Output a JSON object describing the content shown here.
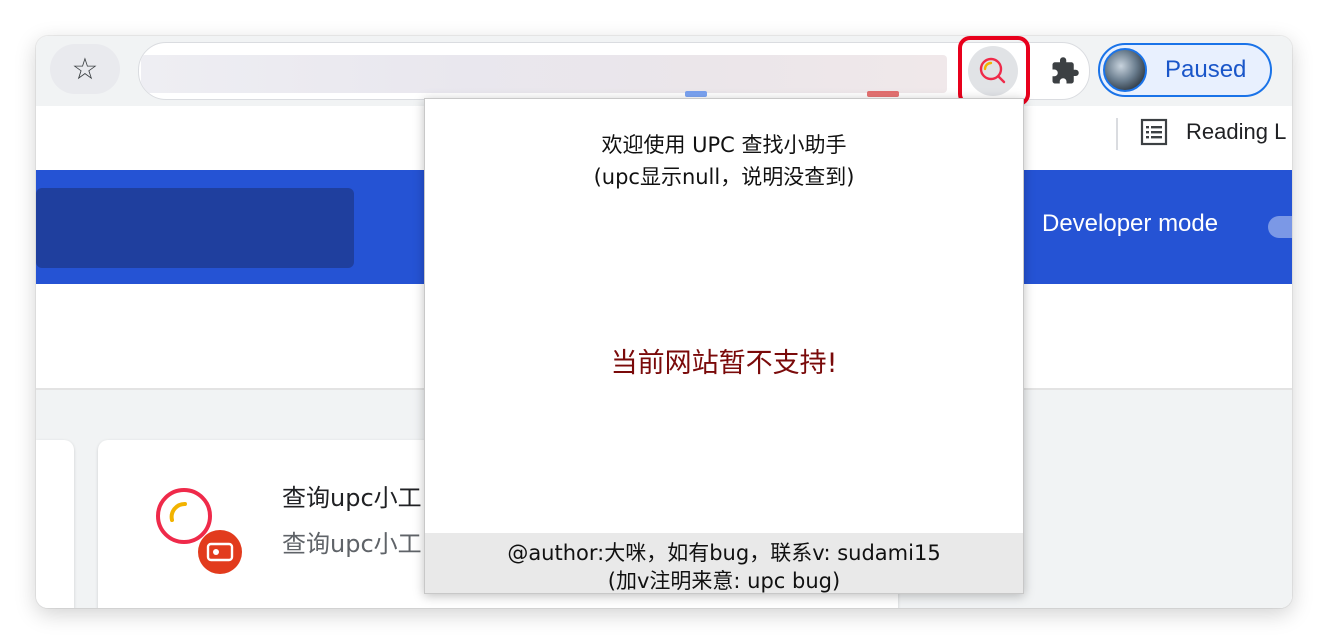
{
  "toolbar": {
    "bookmark_star_glyph": "☆",
    "profile_label": "Paused"
  },
  "bookmarks_bar": {
    "reading_list_label": "Reading L"
  },
  "header": {
    "developer_mode_label": "Developer mode",
    "developer_mode_enabled": false
  },
  "extension_card": {
    "name": "查询upc小工",
    "description": "查询upc小工"
  },
  "popup": {
    "welcome": "欢迎使用 UPC 查找小助手",
    "note": "(upc显示null，说明没查到)",
    "message": "当前网站暂不支持!",
    "author": "@author:大咪，如有bug，联系v: sudami15",
    "contact_note": "(加v注明来意: upc bug)"
  },
  "colors": {
    "accent_blue": "#2553d4",
    "highlight_red": "#e8001c",
    "message_red": "#7a0a0a",
    "profile_blue": "#1a73e8"
  },
  "icons": [
    "star-icon",
    "upc-search-extension-icon",
    "puzzle-icon",
    "avatar",
    "reading-list-icon",
    "upc-extension-logo"
  ]
}
